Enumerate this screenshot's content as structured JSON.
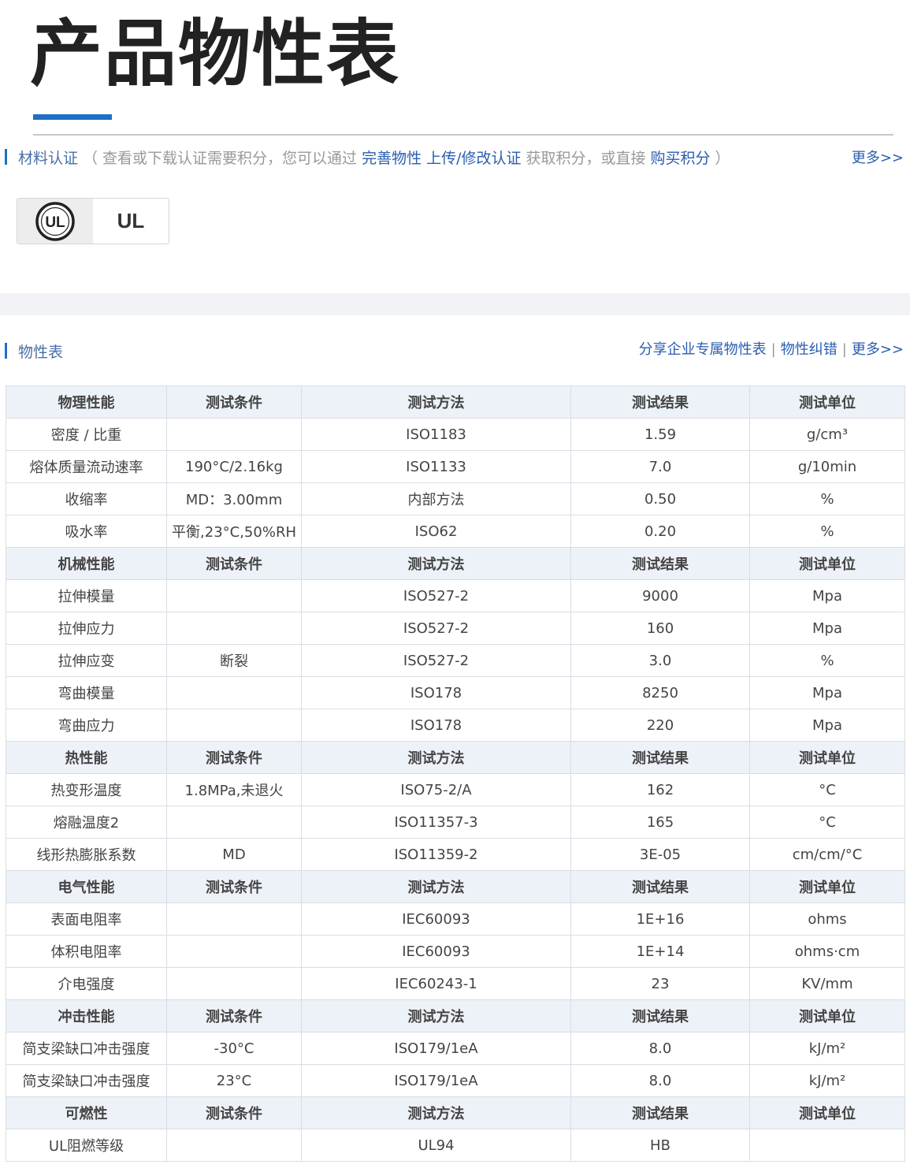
{
  "title": "产品物性表",
  "certification": {
    "label": "材料认证",
    "note_prefix": "（ 查看或下载认证需要积分，您可以通过",
    "link1": "完善物性 上传/修改认证",
    "note_mid": "获取积分，或直接",
    "link2": "购买积分",
    "note_suffix": "）",
    "more": "更多>>",
    "badge": {
      "icon": "ul-logo-icon",
      "logo_text": "UL",
      "label": "UL"
    }
  },
  "properties": {
    "label": "物性表",
    "links": [
      "分享企业专属物性表",
      "物性纠错",
      "更多>>"
    ],
    "separator": "|",
    "groups": [
      {
        "header": [
          "物理性能",
          "测试条件",
          "测试方法",
          "测试结果",
          "测试单位"
        ],
        "rows": [
          [
            "密度 / 比重",
            "",
            "ISO1183",
            "1.59",
            "g/cm³"
          ],
          [
            "熔体质量流动速率",
            "190°C/2.16kg",
            "ISO1133",
            "7.0",
            "g/10min"
          ],
          [
            "收缩率",
            "MD：3.00mm",
            "内部方法",
            "0.50",
            "%"
          ],
          [
            "吸水率",
            "平衡,23°C,50%RH",
            "ISO62",
            "0.20",
            "%"
          ]
        ]
      },
      {
        "header": [
          "机械性能",
          "测试条件",
          "测试方法",
          "测试结果",
          "测试单位"
        ],
        "rows": [
          [
            "拉伸模量",
            "",
            "ISO527-2",
            "9000",
            "Mpa"
          ],
          [
            "拉伸应力",
            "",
            "ISO527-2",
            "160",
            "Mpa"
          ],
          [
            "拉伸应变",
            "断裂",
            "ISO527-2",
            "3.0",
            "%"
          ],
          [
            "弯曲模量",
            "",
            "ISO178",
            "8250",
            "Mpa"
          ],
          [
            "弯曲应力",
            "",
            "ISO178",
            "220",
            "Mpa"
          ]
        ]
      },
      {
        "header": [
          "热性能",
          "测试条件",
          "测试方法",
          "测试结果",
          "测试单位"
        ],
        "rows": [
          [
            "热变形温度",
            "1.8MPa,未退火",
            "ISO75-2/A",
            "162",
            "°C"
          ],
          [
            "熔融温度2",
            "",
            "ISO11357-3",
            "165",
            "°C"
          ],
          [
            "线形热膨胀系数",
            "MD",
            "ISO11359-2",
            "3E-05",
            "cm/cm/°C"
          ]
        ]
      },
      {
        "header": [
          "电气性能",
          "测试条件",
          "测试方法",
          "测试结果",
          "测试单位"
        ],
        "rows": [
          [
            "表面电阻率",
            "",
            "IEC60093",
            "1E+16",
            "ohms"
          ],
          [
            "体积电阻率",
            "",
            "IEC60093",
            "1E+14",
            "ohms·cm"
          ],
          [
            "介电强度",
            "",
            "IEC60243-1",
            "23",
            "KV/mm"
          ]
        ]
      },
      {
        "header": [
          "冲击性能",
          "测试条件",
          "测试方法",
          "测试结果",
          "测试单位"
        ],
        "rows": [
          [
            "简支梁缺口冲击强度",
            "-30°C",
            "ISO179/1eA",
            "8.0",
            "kJ/m²"
          ],
          [
            "简支梁缺口冲击强度",
            "23°C",
            "ISO179/1eA",
            "8.0",
            "kJ/m²"
          ]
        ]
      },
      {
        "header": [
          "可燃性",
          "测试条件",
          "测试方法",
          "测试结果",
          "测试单位"
        ],
        "rows": [
          [
            "UL阻燃等级",
            "",
            "UL94",
            "HB",
            ""
          ]
        ]
      }
    ]
  },
  "colors": {
    "accent": "#1f6fc5",
    "link": "#2a5db0",
    "header_bg": "#edf2f8",
    "border": "#d9dde3"
  }
}
